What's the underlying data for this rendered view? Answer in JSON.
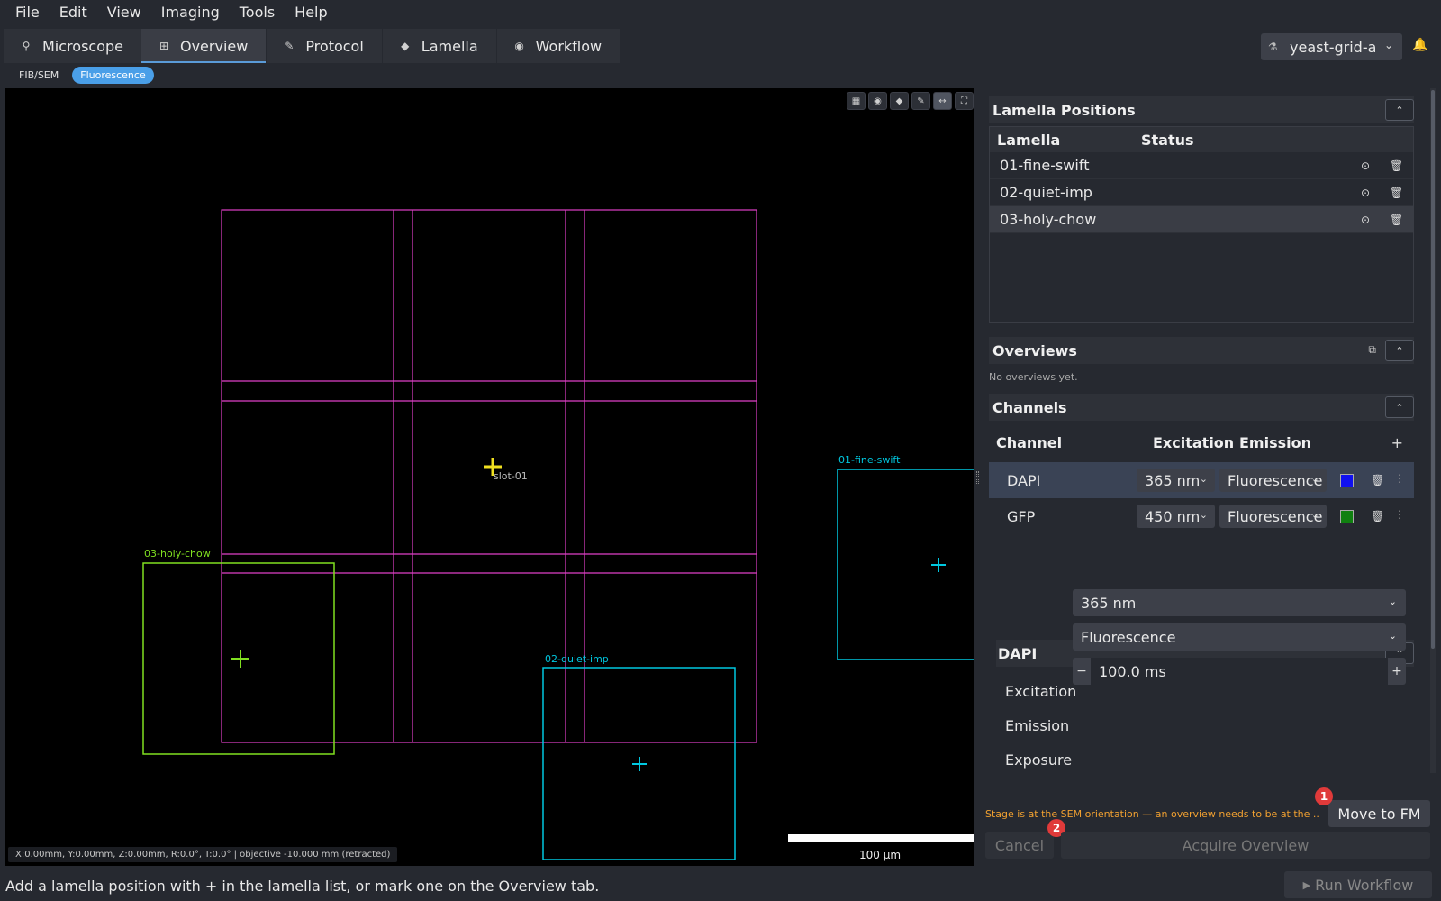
{
  "menu": [
    "File",
    "Edit",
    "View",
    "Imaging",
    "Tools",
    "Help"
  ],
  "tabs": [
    {
      "label": "Microscope",
      "icon": "microscope-icon"
    },
    {
      "label": "Overview",
      "icon": "map-icon"
    },
    {
      "label": "Protocol",
      "icon": "document-icon"
    },
    {
      "label": "Lamella",
      "icon": "layers-icon"
    },
    {
      "label": "Workflow",
      "icon": "play-circle-icon"
    }
  ],
  "active_tab": "Overview",
  "project": {
    "name": "yeast-grid-a",
    "icon": "flask-icon"
  },
  "subtabs": [
    {
      "label": "FIB/SEM"
    },
    {
      "label": "Fluorescence",
      "active": true
    }
  ],
  "viewer": {
    "grid_label": "slot-01",
    "lamellae": [
      {
        "label": "01-fine-swift",
        "color": "#00c8e0"
      },
      {
        "label": "02-quiet-imp",
        "color": "#00c8e0"
      },
      {
        "label": "03-holy-chow",
        "color": "#80e020"
      }
    ],
    "grid_color": "#e040c8",
    "coords": "X:0.00mm, Y:0.00mm, Z:0.00mm, R:0.0°, T:0.0°   |   objective -10.000 mm (retracted)",
    "scalebar": "100 µm",
    "toolbar": [
      "grid-icon",
      "eye-icon",
      "layers-icon",
      "pencil-icon",
      "measure-icon",
      "fit-icon"
    ]
  },
  "lamella_positions": {
    "title": "Lamella Positions",
    "columns": [
      "Lamella",
      "Status"
    ],
    "rows": [
      {
        "name": "01-fine-swift",
        "status": ""
      },
      {
        "name": "02-quiet-imp",
        "status": ""
      },
      {
        "name": "03-holy-chow",
        "status": ""
      }
    ]
  },
  "overviews": {
    "title": "Overviews",
    "empty": "No overviews yet."
  },
  "channels": {
    "title": "Channels",
    "columns": [
      "Channel",
      "Excitation",
      "Emission"
    ],
    "add": "+",
    "rows": [
      {
        "name": "DAPI",
        "excitation": "365 nm",
        "emission": "Fluorescence",
        "color": "#1010f0"
      },
      {
        "name": "GFP",
        "excitation": "450 nm",
        "emission": "Fluorescence",
        "color": "#108010"
      }
    ]
  },
  "channel_detail": {
    "title": "DAPI",
    "excitation_label": "Excitation",
    "excitation": "365 nm",
    "emission_label": "Emission",
    "emission": "Fluorescence",
    "exposure_label": "Exposure",
    "exposure": "100.0 ms",
    "minus": "−",
    "plus": "+"
  },
  "warning": "Stage is at the SEM orientation — an overview needs to be at the ...",
  "buttons": {
    "move": "Move to FM",
    "cancel": "Cancel",
    "acquire": "Acquire Overview",
    "run": "Run Workflow"
  },
  "badges": [
    "1",
    "2"
  ],
  "status": "Add a lamella position with + in the lamella list, or mark one on the Overview tab."
}
